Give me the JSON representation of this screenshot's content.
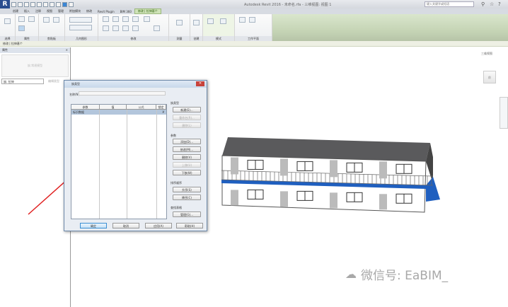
{
  "app": {
    "title": "Autodesk Revit 2016 -   未命名.rfa - 三维视图: 视图 1",
    "search_placeholder": "键入关键字或短语"
  },
  "tabs": [
    "创建",
    "插入",
    "注释",
    "视图",
    "管理",
    "附加模块",
    "修改",
    "Revit Plugin",
    "BIM 360",
    "修改 | 拉伸基个"
  ],
  "active_tab_index": 9,
  "ribbon_panels": [
    "选择",
    "属性",
    "剪贴板",
    "几何图形",
    "修改",
    "测量",
    "创建",
    "模式",
    "工作平面"
  ],
  "context_bar": "修改 | 拉伸基个",
  "properties": {
    "header": "属性",
    "type_selector": "族:常规模型",
    "filter": "族: 拉伸",
    "edit_type": "编辑类型"
  },
  "view": {
    "title": "三维视图",
    "viewcube_label": "前"
  },
  "dialog": {
    "title": "族类型",
    "name_label": "名称(N):",
    "columns": [
      "参数",
      "值",
      "公式",
      "锁定"
    ],
    "group_row": "标识数据",
    "family_types_label": "族类型",
    "family_type_buttons": [
      "新建(E)...",
      "重命名(R)...",
      "删除(L)"
    ],
    "params_label": "参数",
    "param_buttons": [
      "添加(D)...",
      "修改(M)...",
      "删除(V)",
      "上移(U)",
      "下移(W)"
    ],
    "sort_label": "排序顺序",
    "sort_buttons": [
      "升序(S)",
      "降序(C)"
    ],
    "lookup_label": "查找表格",
    "lookup_button": "管理(G)...",
    "bottom_buttons": [
      "确定",
      "取消",
      "应用(A)",
      "帮助(H)"
    ]
  },
  "watermark": "微信号: EaBIM_",
  "colors": {
    "accent_green": "#cfe3b8",
    "arrow": "#e02020",
    "balcony_blue": "#1f5fbf"
  }
}
